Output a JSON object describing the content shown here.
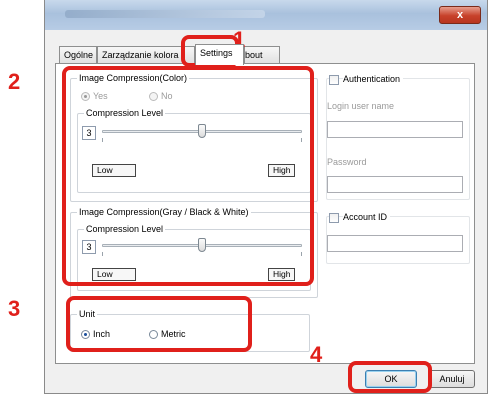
{
  "window": {
    "close_glyph": "x"
  },
  "tabs": [
    {
      "label": "Ogólne"
    },
    {
      "label": "Zarządzanie kolora"
    },
    {
      "label": "Settings"
    },
    {
      "label": "About"
    }
  ],
  "color_compression": {
    "title": "Image Compression(Color)",
    "options": [
      {
        "label": "Yes",
        "selected": true
      },
      {
        "label": "No",
        "selected": false
      }
    ],
    "level_title": "Compression Level",
    "level_value": "3",
    "level_fraction": 0.5,
    "low_label": "Low",
    "high_label": "High"
  },
  "gray_compression": {
    "title": "Image Compression(Gray / Black & White)",
    "level_title": "Compression Level",
    "level_value": "3",
    "level_fraction": 0.5,
    "low_label": "Low",
    "high_label": "High"
  },
  "unit": {
    "title": "Unit",
    "options": [
      {
        "label": "Inch",
        "selected": true
      },
      {
        "label": "Metric",
        "selected": false
      }
    ]
  },
  "authentication": {
    "label": "Authentication",
    "checked": false,
    "login_label": "Login user name",
    "login_value": "",
    "password_label": "Password",
    "password_value": ""
  },
  "account": {
    "label": "Account ID",
    "checked": false,
    "value": ""
  },
  "buttons": {
    "ok": "OK",
    "cancel": "Anuluj"
  },
  "annotations": [
    "1",
    "2",
    "3",
    "4"
  ],
  "colors": {
    "highlight": "#e0201b"
  }
}
